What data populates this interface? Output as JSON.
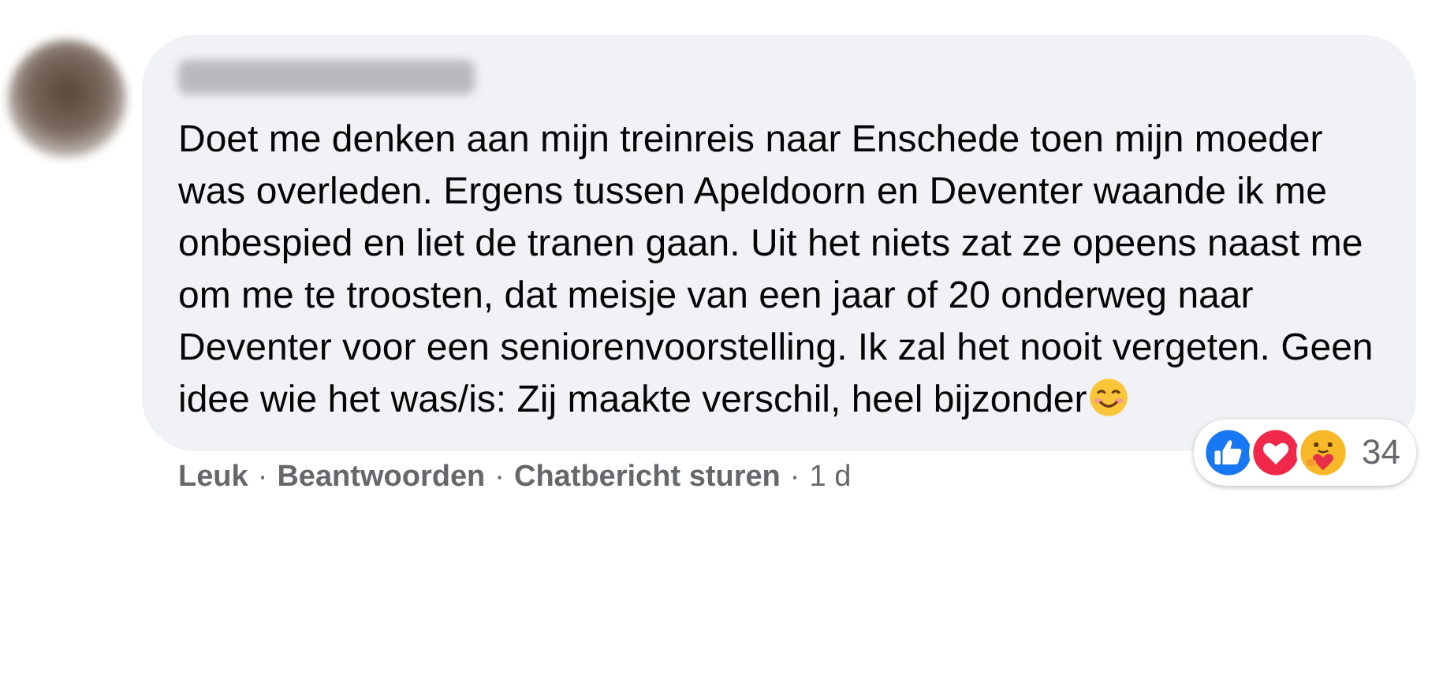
{
  "comment": {
    "text": "Doet me denken aan mijn treinreis naar Enschede toen mijn moeder was overleden. Ergens tussen Apeldoorn en Deventer waande ik me onbespied en liet de tranen gaan. Uit het niets zat ze opeens naast me om me te troosten, dat meisje van een jaar of 20 onderweg naar Deventer voor een seniorenvoorstelling. Ik zal het nooit vergeten. Geen idee wie het was/is: Zij maakte verschil, heel bijzonder"
  },
  "reactions": {
    "count": "34"
  },
  "footer": [
    {
      "kind": "link",
      "label": "Leuk"
    },
    {
      "kind": "separator",
      "label": "·"
    },
    {
      "kind": "link",
      "label": "Beantwoorden"
    },
    {
      "kind": "separator",
      "label": "·"
    },
    {
      "kind": "link",
      "label": "Chatbericht sturen"
    },
    {
      "kind": "separator",
      "label": "·"
    },
    {
      "kind": "time",
      "label": "1 d"
    }
  ]
}
